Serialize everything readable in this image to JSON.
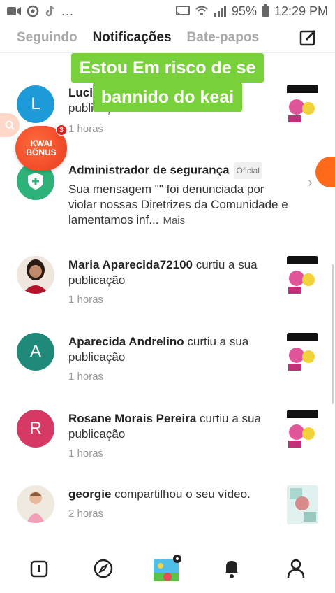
{
  "status_bar": {
    "left_more": "...",
    "battery": "95%",
    "time": "12:29 PM"
  },
  "tabs": [
    {
      "label": "Seguindo",
      "active": false
    },
    {
      "label": "Notificações",
      "active": true
    },
    {
      "label": "Bate-papos",
      "active": false
    }
  ],
  "overlay": {
    "line1": "Estou Em risco de se",
    "line2": "bannido do keai"
  },
  "kwai_bubble": {
    "line1": "KWAI",
    "line2": "BÔNUS",
    "badge": "3"
  },
  "notifications": [
    {
      "avatar_letter": "L",
      "name": "Luci",
      "action": "",
      "sub": "publicação",
      "time": "1 horas",
      "avatar_color": "#1d9bd8"
    },
    {
      "name": "Administrador de segurança",
      "badge": "Oficial",
      "message": "Sua mensagem \"\" foi denunciada por violar nossas Diretrizes da Comunidade e lamentamos inf...",
      "more": "Mais",
      "avatar_color": "#2db37a"
    },
    {
      "name": "Maria Aparecida72100",
      "action": "curtiu a sua publicação",
      "time": "1 horas"
    },
    {
      "avatar_letter": "A",
      "name": "Aparecida Andrelino",
      "action": "curtiu a sua publicação",
      "time": "1 horas",
      "avatar_color": "#1f8a7a"
    },
    {
      "avatar_letter": "R",
      "name": "Rosane Morais Pereira",
      "action": "curtiu a sua publicação",
      "time": "1 horas",
      "avatar_color": "#d63a64"
    },
    {
      "name": "georgie",
      "action": "compartilhou o seu vídeo.",
      "time": "2 horas"
    }
  ],
  "bottom_nav": [
    "home-icon",
    "discover-icon",
    "create-icon",
    "notifications-icon",
    "profile-icon"
  ]
}
